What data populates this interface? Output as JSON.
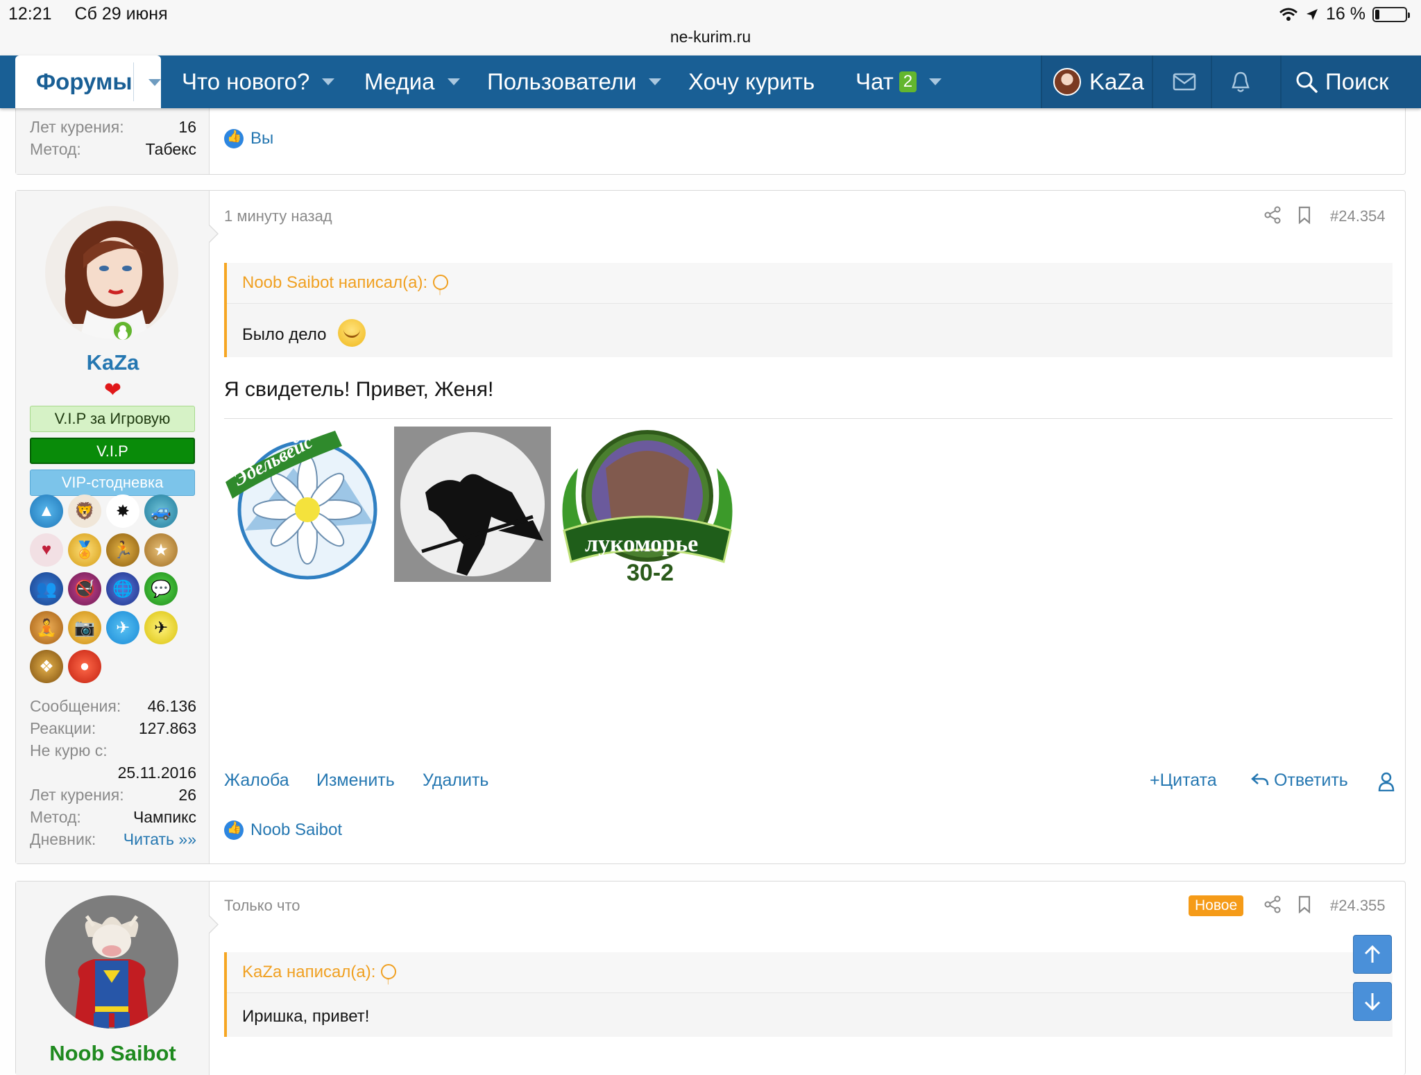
{
  "status_bar": {
    "time": "12:21",
    "date": "Сб 29 июня",
    "url": "ne-kurim.ru",
    "battery": "16 %"
  },
  "nav": {
    "forums": "Форумы",
    "whats_new": "Что нового?",
    "media": "Медиа",
    "users": "Пользователи",
    "want_smoke": "Хочу курить",
    "chat": "Чат",
    "chat_count": "2",
    "username": "KaZa",
    "search": "Поиск"
  },
  "prev_post": {
    "stats": [
      {
        "k": "Лет курения:",
        "v": "16"
      },
      {
        "k": "Метод:",
        "v": "Табекс"
      }
    ],
    "reaction": "Вы"
  },
  "post1": {
    "time": "1 минуту назад",
    "number": "#24.354",
    "author": "KaZa",
    "banners": [
      "V.I.P за Игровую",
      "V.I.P",
      "VIP-стодневка"
    ],
    "stats": [
      {
        "k": "Сообщения:",
        "v": "46.136"
      },
      {
        "k": "Реакции:",
        "v": "127.863"
      },
      {
        "k": "Не курю с:",
        "v": ""
      },
      {
        "k": "",
        "v": "25.11.2016"
      },
      {
        "k": "Лет курения:",
        "v": "26"
      },
      {
        "k": "Метод:",
        "v": "Чампикс"
      },
      {
        "k": "Дневник:",
        "v": "Читать »»"
      }
    ],
    "quote_author": "Noob Saibot написал(а):",
    "quote_text": "Было дело",
    "text": "Я свидетель! Привет, Женя!",
    "images": [
      {
        "caption": "Эдельвейс"
      },
      {
        "caption": ""
      },
      {
        "caption": "лукоморье",
        "sub": "30-2"
      }
    ],
    "actions": {
      "report": "Жалоба",
      "edit": "Изменить",
      "delete": "Удалить",
      "quote": "Цитата",
      "reply": "Ответить"
    },
    "reaction": "Noob Saibot"
  },
  "post2": {
    "time": "Только что",
    "badge": "Новое",
    "number": "#24.355",
    "author": "Noob Saibot",
    "quote_author": "KaZa написал(а):",
    "quote_text": "Иришка, привет!"
  },
  "colors": {
    "nav": "#195f95",
    "link": "#2577b1",
    "quote_accent": "#f6a623",
    "online": "#63b62f"
  }
}
